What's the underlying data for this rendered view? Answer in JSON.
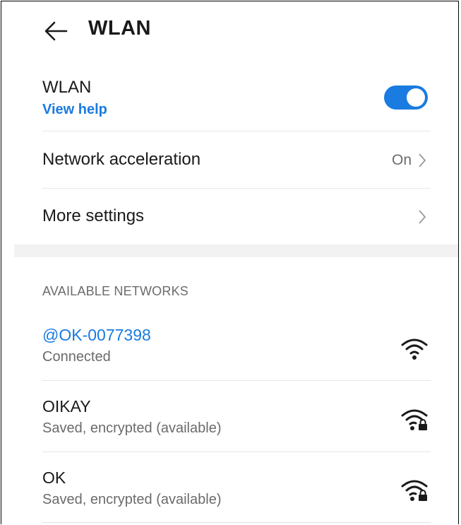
{
  "header": {
    "title": "WLAN",
    "back_icon": "arrow-left-icon"
  },
  "wlan": {
    "label": "WLAN",
    "help_link": "View help",
    "enabled": true,
    "accent_color": "#1a7be0"
  },
  "settings": [
    {
      "label": "Network acceleration",
      "value": "On"
    },
    {
      "label": "More settings",
      "value": ""
    }
  ],
  "section_title": "AVAILABLE NETWORKS",
  "networks": [
    {
      "name": "@OK-0077398",
      "status": "Connected",
      "active": true,
      "icon": "wifi-full-icon"
    },
    {
      "name": "OIKAY",
      "status": "Saved, encrypted (available)",
      "active": false,
      "icon": "wifi-locked-icon"
    },
    {
      "name": "OK",
      "status": "Saved, encrypted (available)",
      "active": false,
      "icon": "wifi-locked-icon"
    }
  ]
}
